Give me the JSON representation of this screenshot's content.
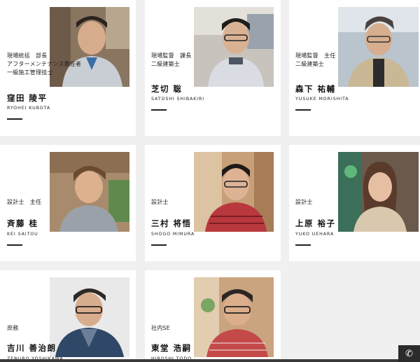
{
  "staff": [
    {
      "role": "現場統括　部長\nアフターメンテナンス責任者\n一級施工管理技士",
      "name": "窪田 陵平",
      "roman": "RYOHEI KUBOTA"
    },
    {
      "role": "現場監督　課長\n二級建築士",
      "name": "芝切 聡",
      "roman": "SATOSHI SHIBAKIRI"
    },
    {
      "role": "現場監督　主任\n二級建築士",
      "name": "森下 祐輔",
      "roman": "YUSUKE MORISHITA"
    },
    {
      "role": "設計士　主任",
      "name": "斉藤 桂",
      "roman": "KEI SAITOU"
    },
    {
      "role": "設計士",
      "name": "三村 将悟",
      "roman": "SHOGO MIMURA"
    },
    {
      "role": "設計士",
      "name": "上原 裕子",
      "roman": "YUKO UEHARA"
    },
    {
      "role": "庶務",
      "name": "吉川 善治朗",
      "roman": "ZENJIRO YOSHIKAWA"
    },
    {
      "role": "社内SE",
      "name": "東堂 浩嗣",
      "roman": "HIROSHI TODO"
    }
  ],
  "phone_icon": "phone-icon",
  "colors": {
    "page_bg": "#f0f0f0",
    "card_bg": "#ffffff",
    "accent": "#222222"
  }
}
